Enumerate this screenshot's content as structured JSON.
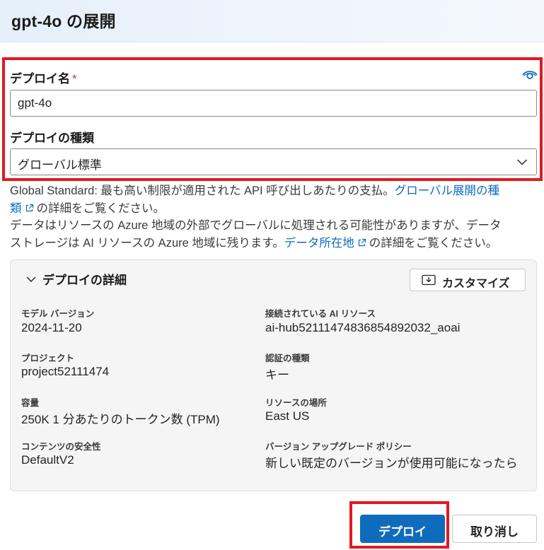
{
  "header": {
    "title": "gpt-4o の展開"
  },
  "form": {
    "deploy_name_label": "デプロイ名",
    "required_mark": "*",
    "deploy_name_value": "gpt-4o",
    "deploy_type_label": "デプロイの種類",
    "deploy_type_value": "グローバル標準"
  },
  "description": {
    "line1": "Global Standard: 最も高い制限が適用された API 呼び出しあたりの支払。",
    "link1_part1": "グローバル展開の種",
    "link1_part2": "類",
    "line2_rest": "の詳細をご覧ください。",
    "line3": "データはリソースの Azure 地域の外部でグローバルに処理される可能性がありますが、データ",
    "line4": "ストレージは AI リソースの Azure 地域に残ります。",
    "link2": "データ所在地",
    "line4_rest": "の詳細をご覧ください。"
  },
  "details": {
    "title": "デプロイの詳細",
    "customize_label": "カスタマイズ",
    "fields": [
      {
        "label": "モデル バージョン",
        "value": "2024-11-20"
      },
      {
        "label": "接続されている AI リソース",
        "value": "ai-hub52111474836854892032_aoai"
      },
      {
        "label": "プロジェクト",
        "value": "project52111474"
      },
      {
        "label": "認証の種類",
        "value": "キー"
      },
      {
        "label": "容量",
        "value": "250K 1 分あたりのトークン数 (TPM)"
      },
      {
        "label": "リソースの場所",
        "value": "East US"
      },
      {
        "label": "コンテンツの安全性",
        "value": "DefaultV2"
      },
      {
        "label": "バージョン アップグレード ポリシー",
        "value": "新しい既定のバージョンが使用可能になったら"
      }
    ]
  },
  "footer": {
    "deploy_label": "デプロイ",
    "cancel_label": "取り消し"
  },
  "colors": {
    "accent": "#0f6cbd",
    "highlight": "#e4181f"
  }
}
